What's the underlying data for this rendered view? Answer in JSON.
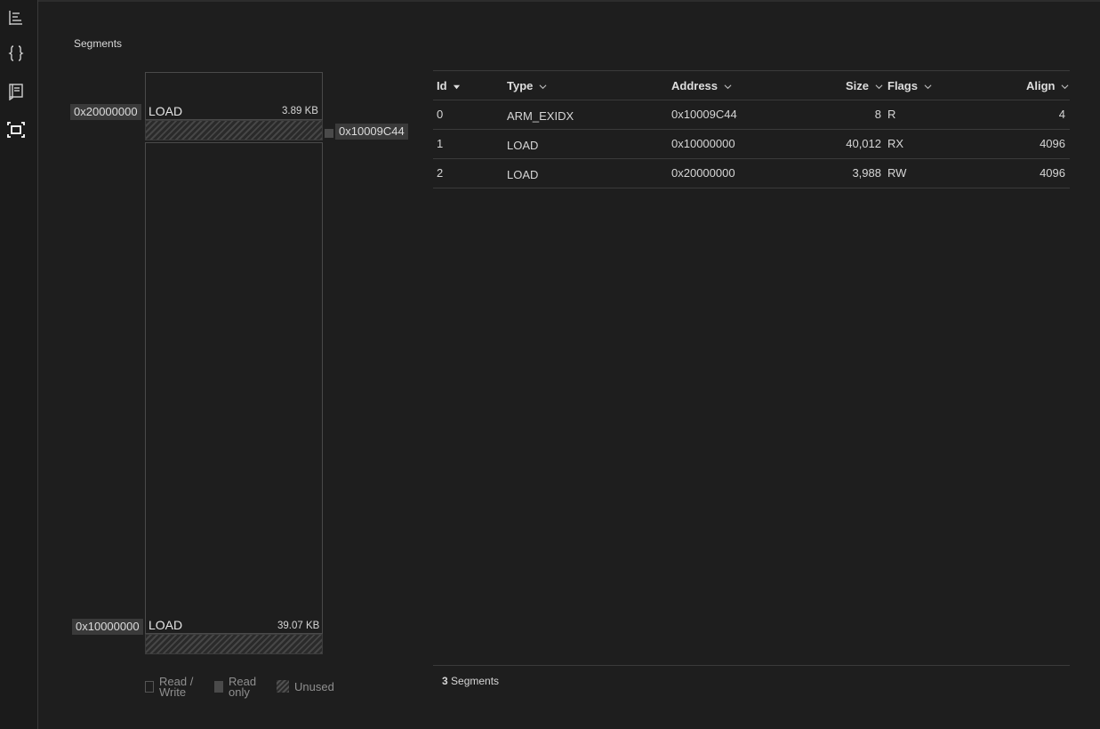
{
  "sidebar": {
    "icons": [
      "align-left-icon",
      "braces-icon",
      "book-icon",
      "segments-icon"
    ]
  },
  "panel": {
    "title": "Segments"
  },
  "memory_map": {
    "segments": [
      {
        "address": "0x20000000",
        "name": "LOAD",
        "size": "3.89 KB"
      },
      {
        "address": "0x10000000",
        "name": "LOAD",
        "size": "39.07 KB"
      }
    ],
    "marker_address": "0x10009C44"
  },
  "legend": {
    "read_write_line1": "Read /",
    "read_write_line2": "Write",
    "read_only_line1": "Read",
    "read_only_line2": "only",
    "unused": "Unused"
  },
  "table": {
    "columns": [
      "Id",
      "Type",
      "Address",
      "Size",
      "Flags",
      "Align"
    ],
    "sorted_by": "Id",
    "rows": [
      {
        "id": "0",
        "type": "ARM_EXIDX",
        "address": "0x10009C44",
        "size": "8",
        "flags": "R",
        "align": "4"
      },
      {
        "id": "1",
        "type": "LOAD",
        "address": "0x10000000",
        "size": "40,012",
        "flags": "RX",
        "align": "4096"
      },
      {
        "id": "2",
        "type": "LOAD",
        "address": "0x20000000",
        "size": "3,988",
        "flags": "RW",
        "align": "4096"
      }
    ]
  },
  "footer": {
    "count": "3",
    "label": "Segments"
  },
  "colors": {
    "background": "#1e1e1e",
    "border": "#3a3a3a",
    "text": "#d4d4d4"
  }
}
